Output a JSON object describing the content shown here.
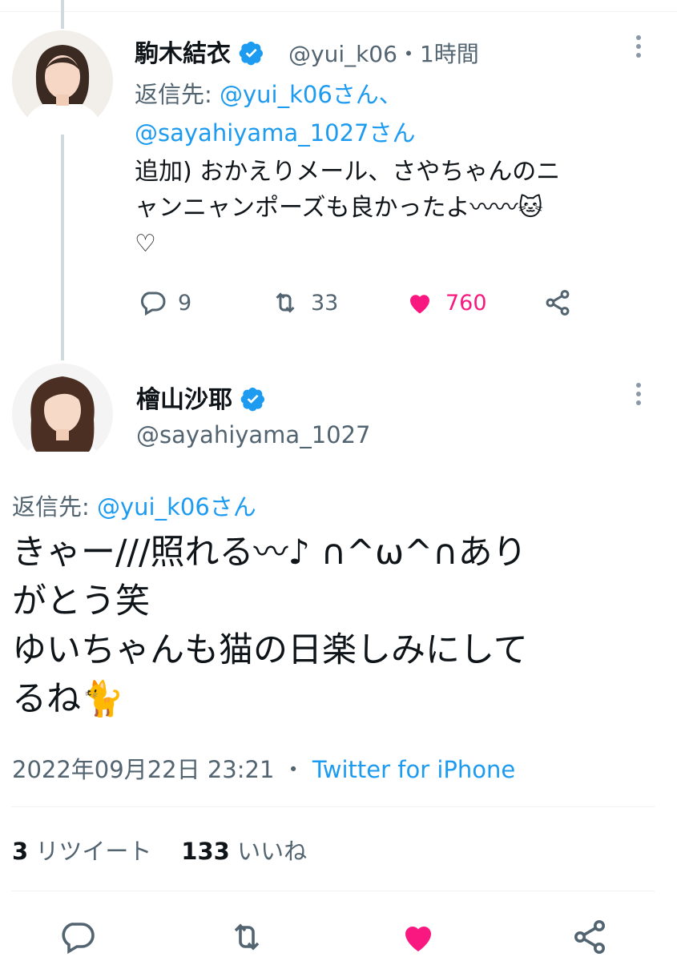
{
  "reply_tweet": {
    "author_name": "駒木結衣",
    "handle": "@yui_k06",
    "time": "・1時間",
    "reply_to_label": "返信先:",
    "reply_to_line1": "@yui_k06さん、",
    "reply_to_line2": "@sayahiyama_1027さん",
    "text_line1": "追加) おかえりメール、さやちゃんのニ",
    "text_line2": "ャンニャンポーズも良かったよ〰〰🐱",
    "text_line3": "♡",
    "reply_count": "9",
    "retweet_count": "33",
    "like_count": "760"
  },
  "main_tweet": {
    "author_name": "檜山沙耶",
    "handle": "@sayahiyama_1027",
    "reply_to_label": "返信先:",
    "reply_to": "@yui_k06さん",
    "text_line1": "きゃー///照れる〰♪ ∩^ω^∩あり",
    "text_line2": "がとう笑",
    "text_line3": "ゆいちゃんも猫の日楽しみにして",
    "text_line4": "るね🐈",
    "timestamp": "2022年09月22日 23:21",
    "dot": "・",
    "source": "Twitter for iPhone",
    "retweets_num": "3",
    "retweets_label": "リツイート",
    "likes_num": "133",
    "likes_label": "いいね"
  },
  "colors": {
    "accent": "#1d9bf0",
    "like": "#f91880",
    "muted": "#536471",
    "divider": "#eff3f4"
  },
  "icons": [
    "verified-icon",
    "more-icon",
    "reply-icon",
    "retweet-icon",
    "like-icon",
    "share-icon"
  ]
}
